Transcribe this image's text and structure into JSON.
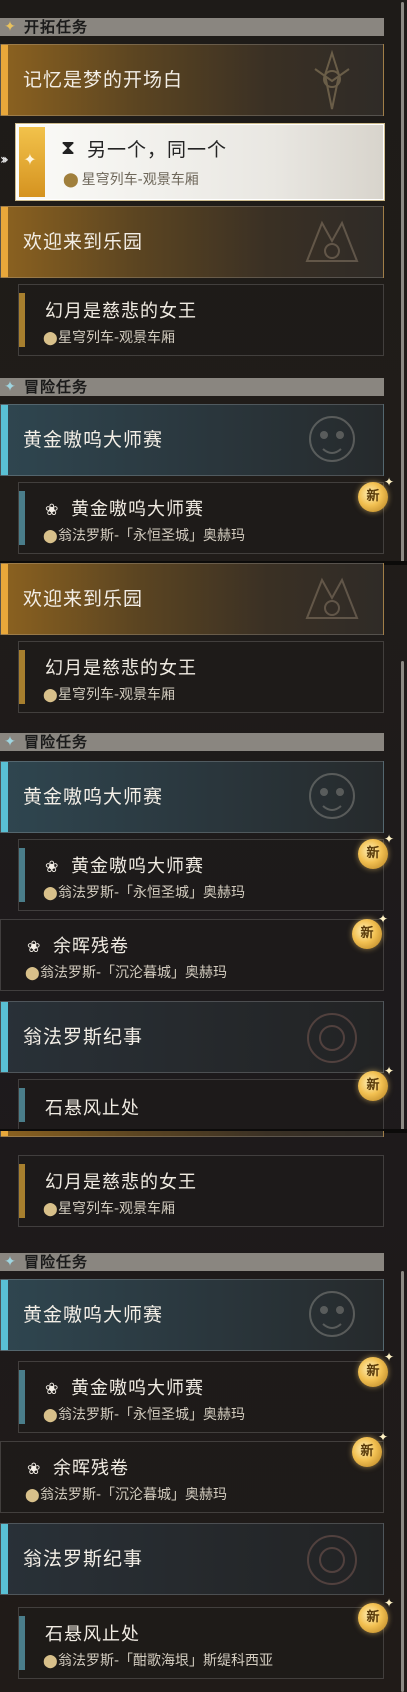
{
  "categories": {
    "trailblaze": "开拓任务",
    "adventure": "冒险任务"
  },
  "missions": {
    "memory": "记忆是梦的开场白",
    "welcome": "欢迎来到乐园",
    "golden": "黄金嗷呜大师赛",
    "chronicle": "翁法罗斯纪事"
  },
  "subs": {
    "same_other": {
      "title": "另一个，同一个",
      "loc": "星穹列车-观景车厢"
    },
    "moon_queen": {
      "title": "幻月是慈悲的女王",
      "loc": "星穹列车-观景车厢"
    },
    "golden_sub": {
      "title": "黄金嗷呜大师赛",
      "loc": "翁法罗斯-「永恒圣城」奥赫玛"
    },
    "afterglow": {
      "title": "余晖残卷",
      "loc": "翁法罗斯-「沉沦暮城」奥赫玛"
    },
    "rock": {
      "title": "石悬风止处",
      "loc": "翁法罗斯-「酣歌海垠」斯缇科西亚"
    }
  },
  "badge_text": "新",
  "icons": {
    "category": "diamond-icon",
    "location": "map-pin-icon",
    "event": "dango-icon",
    "hourglass": "hourglass-icon",
    "selector": "double-chevron-right-icon",
    "badge_spark": "sparkle-icon"
  },
  "colors": {
    "trail_accent": "#e8a73a",
    "adventure_accent": "#59c0d4",
    "badge": "#f2c051"
  }
}
